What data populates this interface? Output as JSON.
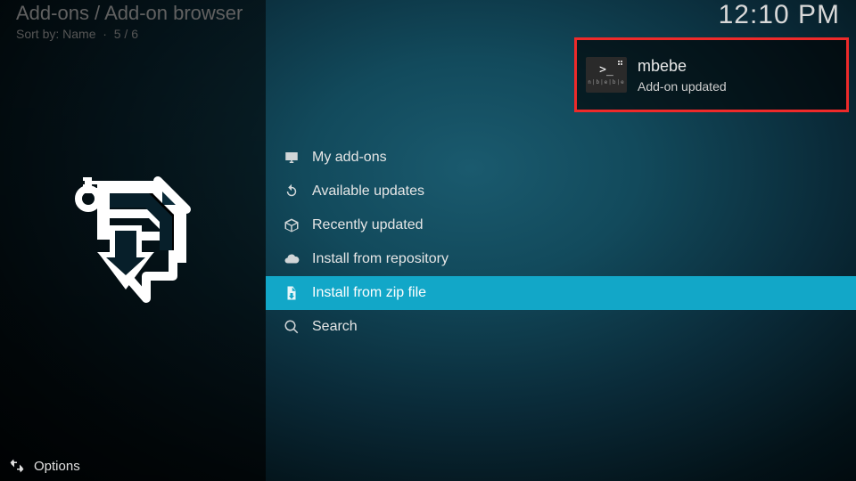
{
  "header": {
    "breadcrumb": "Add-ons / Add-on browser",
    "sort_prefix": "Sort by:",
    "sort_value": "Name",
    "counter": "5 / 6",
    "clock": "12:10 PM"
  },
  "menu": {
    "items": [
      {
        "icon": "monitor-icon",
        "label": "My add-ons",
        "selected": false
      },
      {
        "icon": "refresh-icon",
        "label": "Available updates",
        "selected": false
      },
      {
        "icon": "box-icon",
        "label": "Recently updated",
        "selected": false
      },
      {
        "icon": "cloud-icon",
        "label": "Install from repository",
        "selected": false
      },
      {
        "icon": "zip-download-icon",
        "label": "Install from zip file",
        "selected": true
      },
      {
        "icon": "search-icon",
        "label": "Search",
        "selected": false
      }
    ]
  },
  "notification": {
    "title": "mbebe",
    "subtitle": "Add-on updated",
    "icon_text": "n|b|e|b|e"
  },
  "footer": {
    "options_label": "Options"
  }
}
